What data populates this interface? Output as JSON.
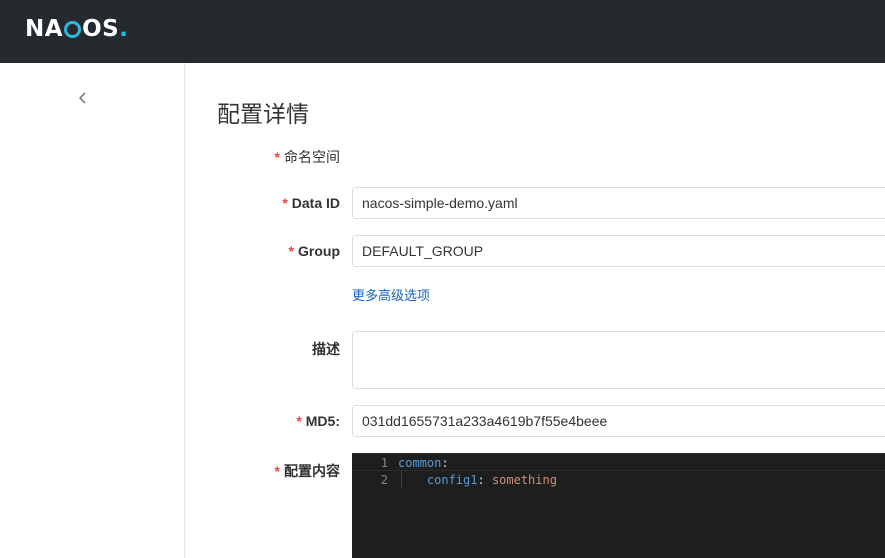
{
  "app": {
    "logo_text_left": "NA",
    "logo_text_right": "OS",
    "logo_dot": ".",
    "accent": "#2bb8e0",
    "topbar_color": "#252a2f"
  },
  "page": {
    "title": "配置详情"
  },
  "form": {
    "required_mark": "*",
    "namespace_label": "命名空间",
    "data_id_label": "Data ID",
    "data_id_value": "nacos-simple-demo.yaml",
    "group_label": "Group",
    "group_value": "DEFAULT_GROUP",
    "advanced_link": "更多高级选项",
    "description_label": "描述",
    "description_value": "",
    "md5_label": "MD5:",
    "md5_value": "031dd1655731a233a4619b7f55e4beee",
    "content_label": "配置内容"
  },
  "editor": {
    "lines": [
      {
        "number": "1",
        "key": "common",
        "punc": ":",
        "value": ""
      },
      {
        "number": "2",
        "indent": "    ",
        "key": "config1",
        "punc": ": ",
        "value": "something"
      }
    ]
  }
}
